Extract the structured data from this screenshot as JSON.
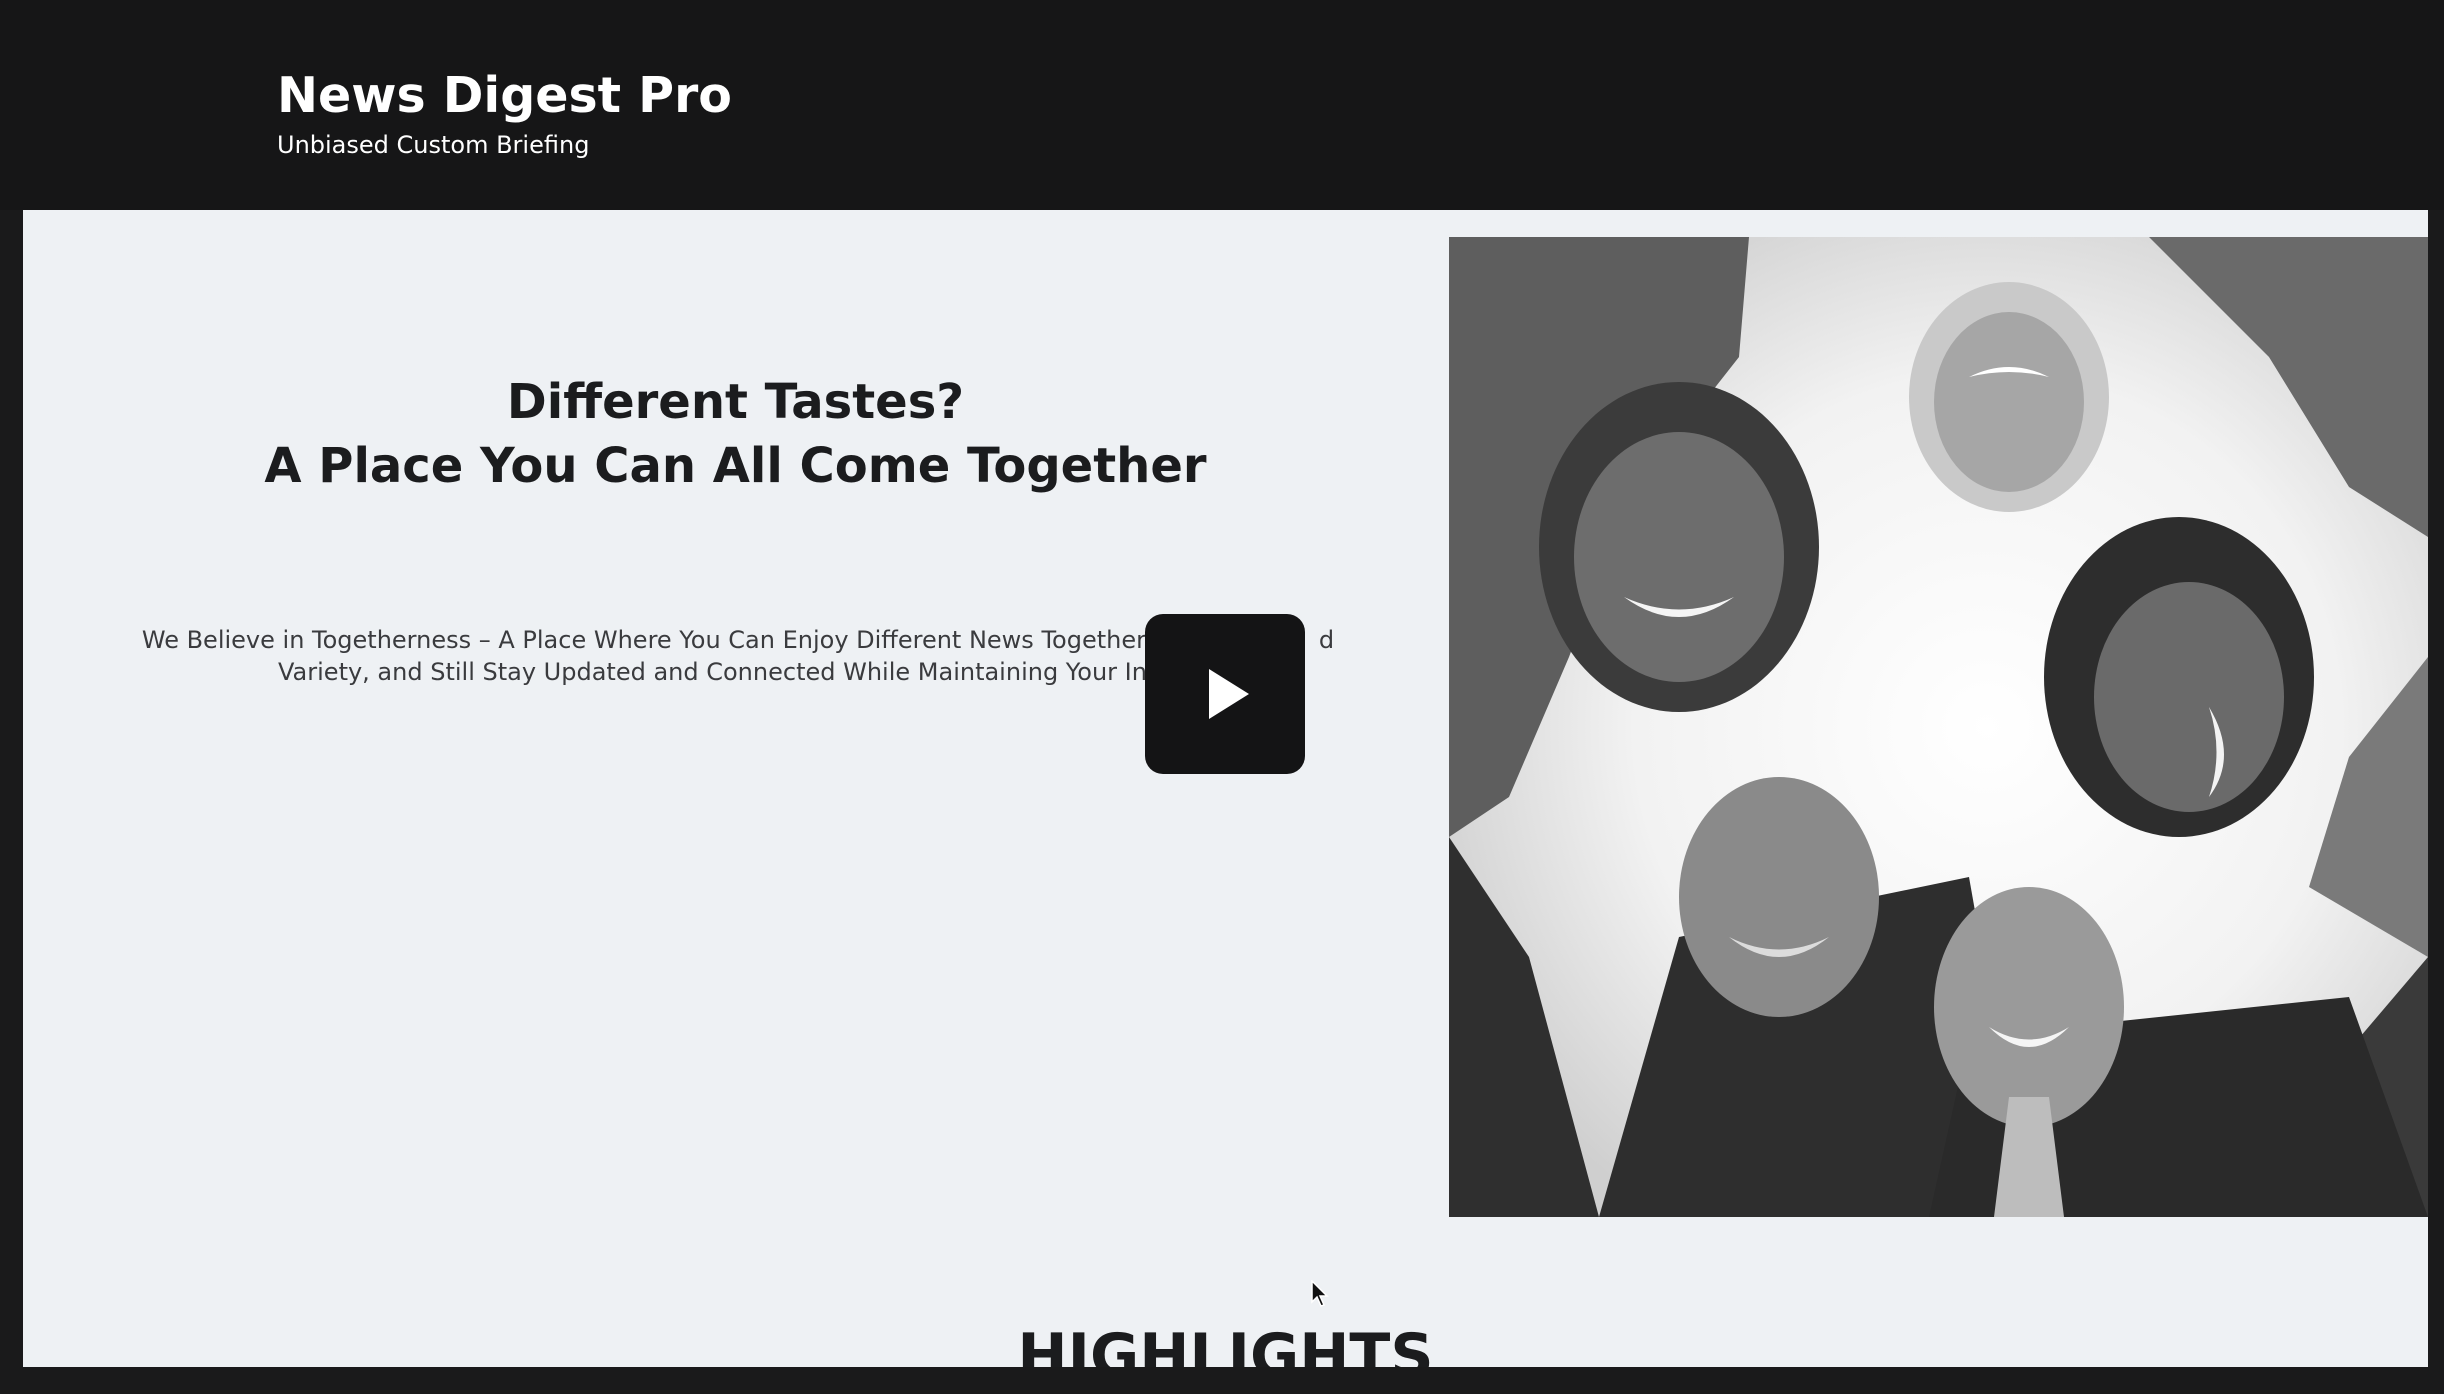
{
  "header": {
    "site_title": "News Digest Pro",
    "tagline": "Unbiased Custom Briefing"
  },
  "hero": {
    "heading_line1": "Different Tastes?",
    "heading_line2": "A Place You Can All Come Together",
    "body_line1": "We Believe in Togetherness – A Place Where You Can Enjoy Different News Together,",
    "body_line1_tail": "d",
    "body_line2": "Variety, and Still Stay Updated and Connected While Maintaining Your Individ",
    "play_button_icon": "play-icon",
    "image_alt": "group-of-people-photo"
  },
  "highlights": {
    "heading": "HIGHLIGHTS"
  },
  "colors": {
    "header_bg": "#161617",
    "main_bg": "#eef1f4",
    "text_dark": "#1b1c1e",
    "play_bg": "#141415"
  }
}
